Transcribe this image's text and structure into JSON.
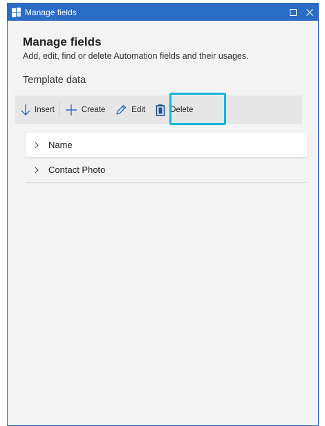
{
  "window": {
    "title": "Manage fields",
    "app_icon": "puzzle-icon",
    "maximize_icon": "maximize-icon",
    "close_icon": "close-icon"
  },
  "header": {
    "title": "Manage fields",
    "subtitle": "Add, edit, find or delete Automation fields and their usages."
  },
  "section": {
    "title": "Template data"
  },
  "toolbar": {
    "insert_label": "Insert",
    "create_label": "Create",
    "edit_label": "Edit",
    "delete_label": "Delete",
    "insert_icon": "arrow-down-icon",
    "create_icon": "plus-icon",
    "edit_icon": "pencil-icon",
    "delete_icon": "trash-icon"
  },
  "fields": [
    {
      "label": "Name"
    },
    {
      "label": "Contact Photo"
    }
  ],
  "colors": {
    "titlebar": "#2b6cc4",
    "highlight": "#17b3d8",
    "toolbar_bg": "#e6e6e6",
    "panel_bg": "#f3f3f3",
    "icon_blue": "#2b6cc4"
  }
}
